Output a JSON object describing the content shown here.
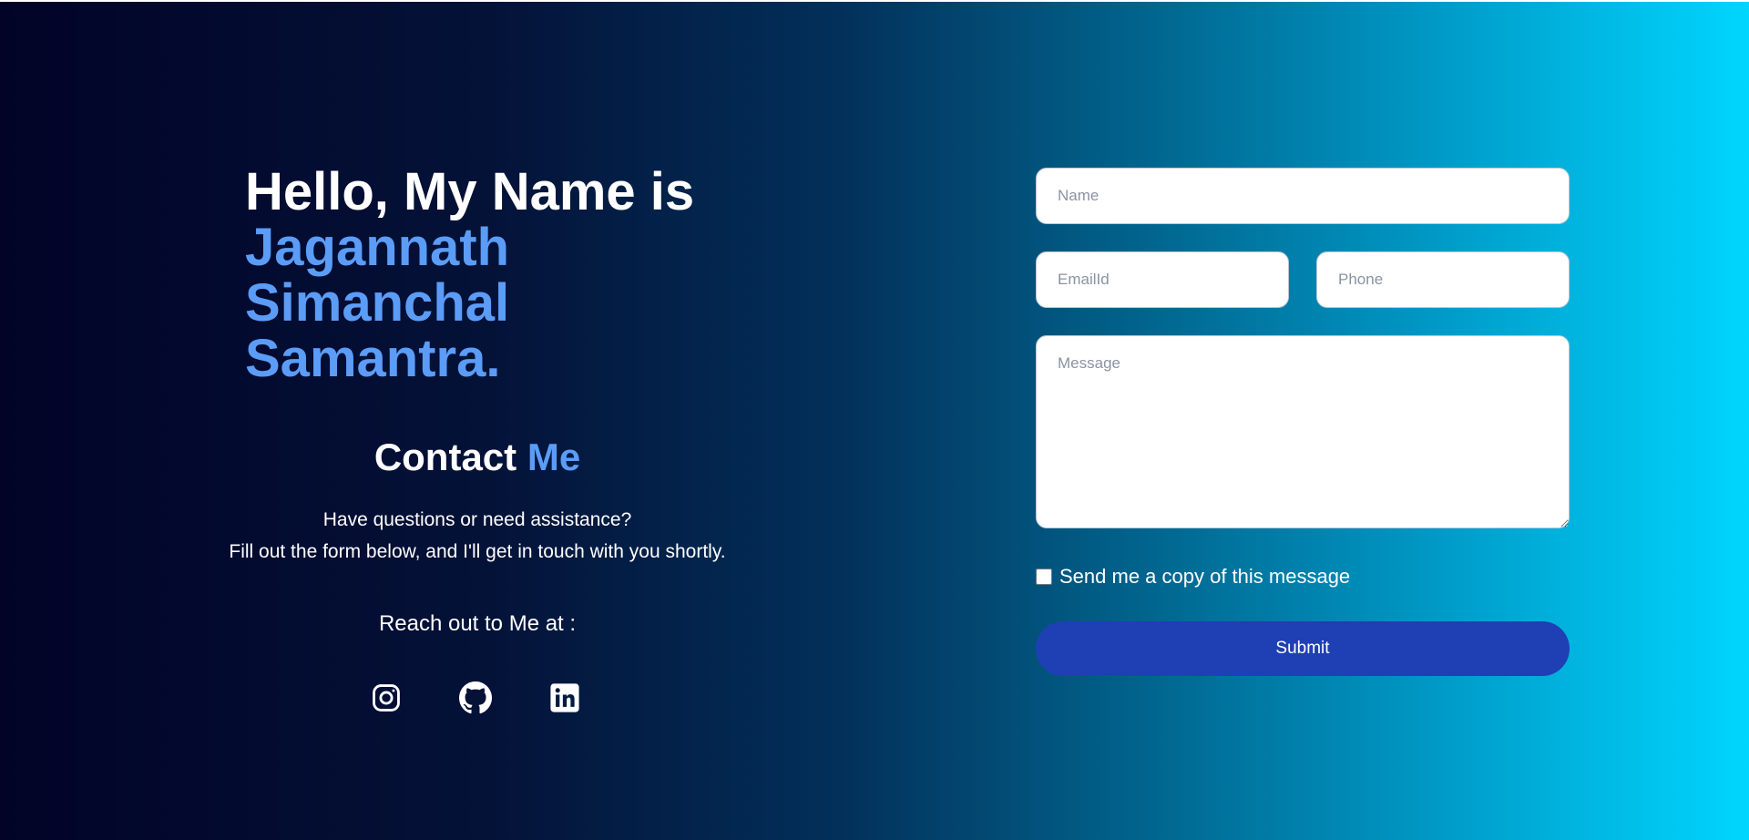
{
  "hero": {
    "greeting": "Hello, My Name is",
    "name": "Jagannath Simanchal Samantra."
  },
  "contact": {
    "heading_part1": "Contact",
    "heading_part2": "Me",
    "line1": "Have questions or need assistance?",
    "line2": "Fill out the form below, and I'll get in touch with you shortly.",
    "reach_label": "Reach out to Me at :"
  },
  "socials": [
    {
      "icon": "instagram-icon"
    },
    {
      "icon": "github-icon"
    },
    {
      "icon": "linkedin-icon"
    }
  ],
  "form": {
    "name_placeholder": "Name",
    "name_value": "",
    "email_placeholder": "EmailId",
    "email_value": "",
    "phone_placeholder": "Phone",
    "phone_value": "",
    "message_placeholder": "Message",
    "message_value": "",
    "copy_label": "Send me a copy of this message",
    "copy_checked": false,
    "submit_label": "Submit"
  },
  "colors": {
    "accent": "#5b9cf6",
    "button": "#1f3fb4",
    "gradient_start": "#020327",
    "gradient_end": "#00d6ff"
  }
}
